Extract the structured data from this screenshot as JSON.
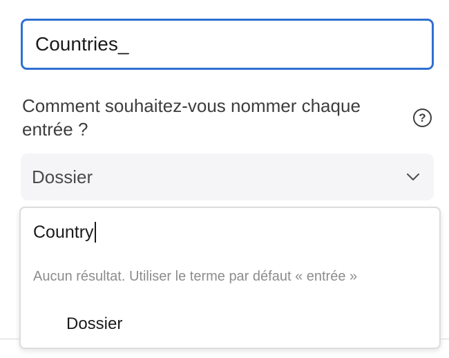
{
  "name_field": {
    "value": "Countries_"
  },
  "question": {
    "label": "Comment souhaitez-vous nommer chaque entrée ?",
    "help_icon": "question-circle-icon"
  },
  "entry_select": {
    "selected": "Dossier",
    "chevron_icon": "chevron-down-icon"
  },
  "dropdown": {
    "search_value": "Country",
    "no_result_text": "Aucun résultat. Utiliser le terme par défaut « entrée »",
    "options": [
      {
        "label": "Dossier"
      }
    ]
  },
  "colors": {
    "focus_border": "#2f6fd0",
    "select_background": "#f5f5f8",
    "muted_text": "#8c8c8c"
  }
}
